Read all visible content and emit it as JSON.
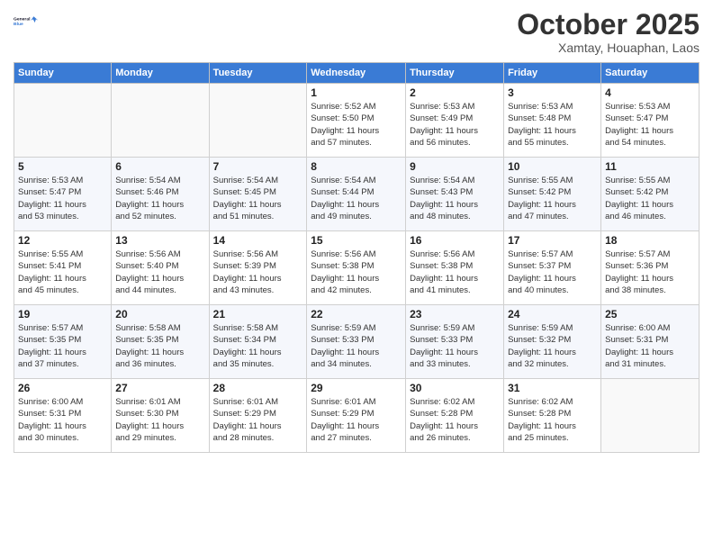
{
  "logo": {
    "line1": "General",
    "line2": "Blue"
  },
  "title": "October 2025",
  "subtitle": "Xamtay, Houaphan, Laos",
  "weekdays": [
    "Sunday",
    "Monday",
    "Tuesday",
    "Wednesday",
    "Thursday",
    "Friday",
    "Saturday"
  ],
  "weeks": [
    [
      {
        "day": "",
        "info": ""
      },
      {
        "day": "",
        "info": ""
      },
      {
        "day": "",
        "info": ""
      },
      {
        "day": "1",
        "info": "Sunrise: 5:52 AM\nSunset: 5:50 PM\nDaylight: 11 hours\nand 57 minutes."
      },
      {
        "day": "2",
        "info": "Sunrise: 5:53 AM\nSunset: 5:49 PM\nDaylight: 11 hours\nand 56 minutes."
      },
      {
        "day": "3",
        "info": "Sunrise: 5:53 AM\nSunset: 5:48 PM\nDaylight: 11 hours\nand 55 minutes."
      },
      {
        "day": "4",
        "info": "Sunrise: 5:53 AM\nSunset: 5:47 PM\nDaylight: 11 hours\nand 54 minutes."
      }
    ],
    [
      {
        "day": "5",
        "info": "Sunrise: 5:53 AM\nSunset: 5:47 PM\nDaylight: 11 hours\nand 53 minutes."
      },
      {
        "day": "6",
        "info": "Sunrise: 5:54 AM\nSunset: 5:46 PM\nDaylight: 11 hours\nand 52 minutes."
      },
      {
        "day": "7",
        "info": "Sunrise: 5:54 AM\nSunset: 5:45 PM\nDaylight: 11 hours\nand 51 minutes."
      },
      {
        "day": "8",
        "info": "Sunrise: 5:54 AM\nSunset: 5:44 PM\nDaylight: 11 hours\nand 49 minutes."
      },
      {
        "day": "9",
        "info": "Sunrise: 5:54 AM\nSunset: 5:43 PM\nDaylight: 11 hours\nand 48 minutes."
      },
      {
        "day": "10",
        "info": "Sunrise: 5:55 AM\nSunset: 5:42 PM\nDaylight: 11 hours\nand 47 minutes."
      },
      {
        "day": "11",
        "info": "Sunrise: 5:55 AM\nSunset: 5:42 PM\nDaylight: 11 hours\nand 46 minutes."
      }
    ],
    [
      {
        "day": "12",
        "info": "Sunrise: 5:55 AM\nSunset: 5:41 PM\nDaylight: 11 hours\nand 45 minutes."
      },
      {
        "day": "13",
        "info": "Sunrise: 5:56 AM\nSunset: 5:40 PM\nDaylight: 11 hours\nand 44 minutes."
      },
      {
        "day": "14",
        "info": "Sunrise: 5:56 AM\nSunset: 5:39 PM\nDaylight: 11 hours\nand 43 minutes."
      },
      {
        "day": "15",
        "info": "Sunrise: 5:56 AM\nSunset: 5:38 PM\nDaylight: 11 hours\nand 42 minutes."
      },
      {
        "day": "16",
        "info": "Sunrise: 5:56 AM\nSunset: 5:38 PM\nDaylight: 11 hours\nand 41 minutes."
      },
      {
        "day": "17",
        "info": "Sunrise: 5:57 AM\nSunset: 5:37 PM\nDaylight: 11 hours\nand 40 minutes."
      },
      {
        "day": "18",
        "info": "Sunrise: 5:57 AM\nSunset: 5:36 PM\nDaylight: 11 hours\nand 38 minutes."
      }
    ],
    [
      {
        "day": "19",
        "info": "Sunrise: 5:57 AM\nSunset: 5:35 PM\nDaylight: 11 hours\nand 37 minutes."
      },
      {
        "day": "20",
        "info": "Sunrise: 5:58 AM\nSunset: 5:35 PM\nDaylight: 11 hours\nand 36 minutes."
      },
      {
        "day": "21",
        "info": "Sunrise: 5:58 AM\nSunset: 5:34 PM\nDaylight: 11 hours\nand 35 minutes."
      },
      {
        "day": "22",
        "info": "Sunrise: 5:59 AM\nSunset: 5:33 PM\nDaylight: 11 hours\nand 34 minutes."
      },
      {
        "day": "23",
        "info": "Sunrise: 5:59 AM\nSunset: 5:33 PM\nDaylight: 11 hours\nand 33 minutes."
      },
      {
        "day": "24",
        "info": "Sunrise: 5:59 AM\nSunset: 5:32 PM\nDaylight: 11 hours\nand 32 minutes."
      },
      {
        "day": "25",
        "info": "Sunrise: 6:00 AM\nSunset: 5:31 PM\nDaylight: 11 hours\nand 31 minutes."
      }
    ],
    [
      {
        "day": "26",
        "info": "Sunrise: 6:00 AM\nSunset: 5:31 PM\nDaylight: 11 hours\nand 30 minutes."
      },
      {
        "day": "27",
        "info": "Sunrise: 6:01 AM\nSunset: 5:30 PM\nDaylight: 11 hours\nand 29 minutes."
      },
      {
        "day": "28",
        "info": "Sunrise: 6:01 AM\nSunset: 5:29 PM\nDaylight: 11 hours\nand 28 minutes."
      },
      {
        "day": "29",
        "info": "Sunrise: 6:01 AM\nSunset: 5:29 PM\nDaylight: 11 hours\nand 27 minutes."
      },
      {
        "day": "30",
        "info": "Sunrise: 6:02 AM\nSunset: 5:28 PM\nDaylight: 11 hours\nand 26 minutes."
      },
      {
        "day": "31",
        "info": "Sunrise: 6:02 AM\nSunset: 5:28 PM\nDaylight: 11 hours\nand 25 minutes."
      },
      {
        "day": "",
        "info": ""
      }
    ]
  ]
}
